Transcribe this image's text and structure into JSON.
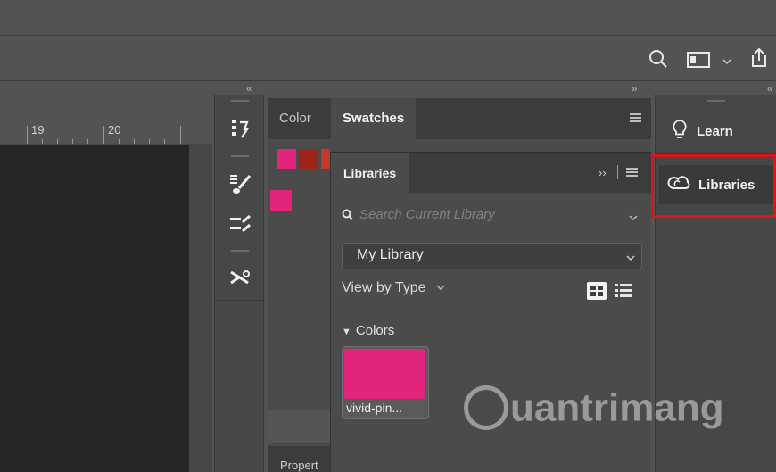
{
  "ruler": {
    "labels": [
      "19",
      "20"
    ]
  },
  "color_panel": {
    "tabs": [
      {
        "label": "Color"
      },
      {
        "label": "Swatches"
      }
    ],
    "swatch_colors": [
      "#e2247c",
      "#a12318",
      "#c0392b",
      "#e2247c"
    ]
  },
  "libraries_panel": {
    "tab": "Libraries",
    "search_placeholder": "Search Current Library",
    "library_select": "My Library",
    "view_by": "View by Type",
    "section_title": "Colors",
    "swatch": {
      "label": "vivid-pin...",
      "color": "#e2247c"
    }
  },
  "properties_tab": "Propert",
  "right_panel": {
    "learn": "Learn",
    "libraries": "Libraries"
  },
  "watermark": "uantrimang",
  "colors": {
    "accent": "#e2247c",
    "highlight": "#e01414"
  }
}
